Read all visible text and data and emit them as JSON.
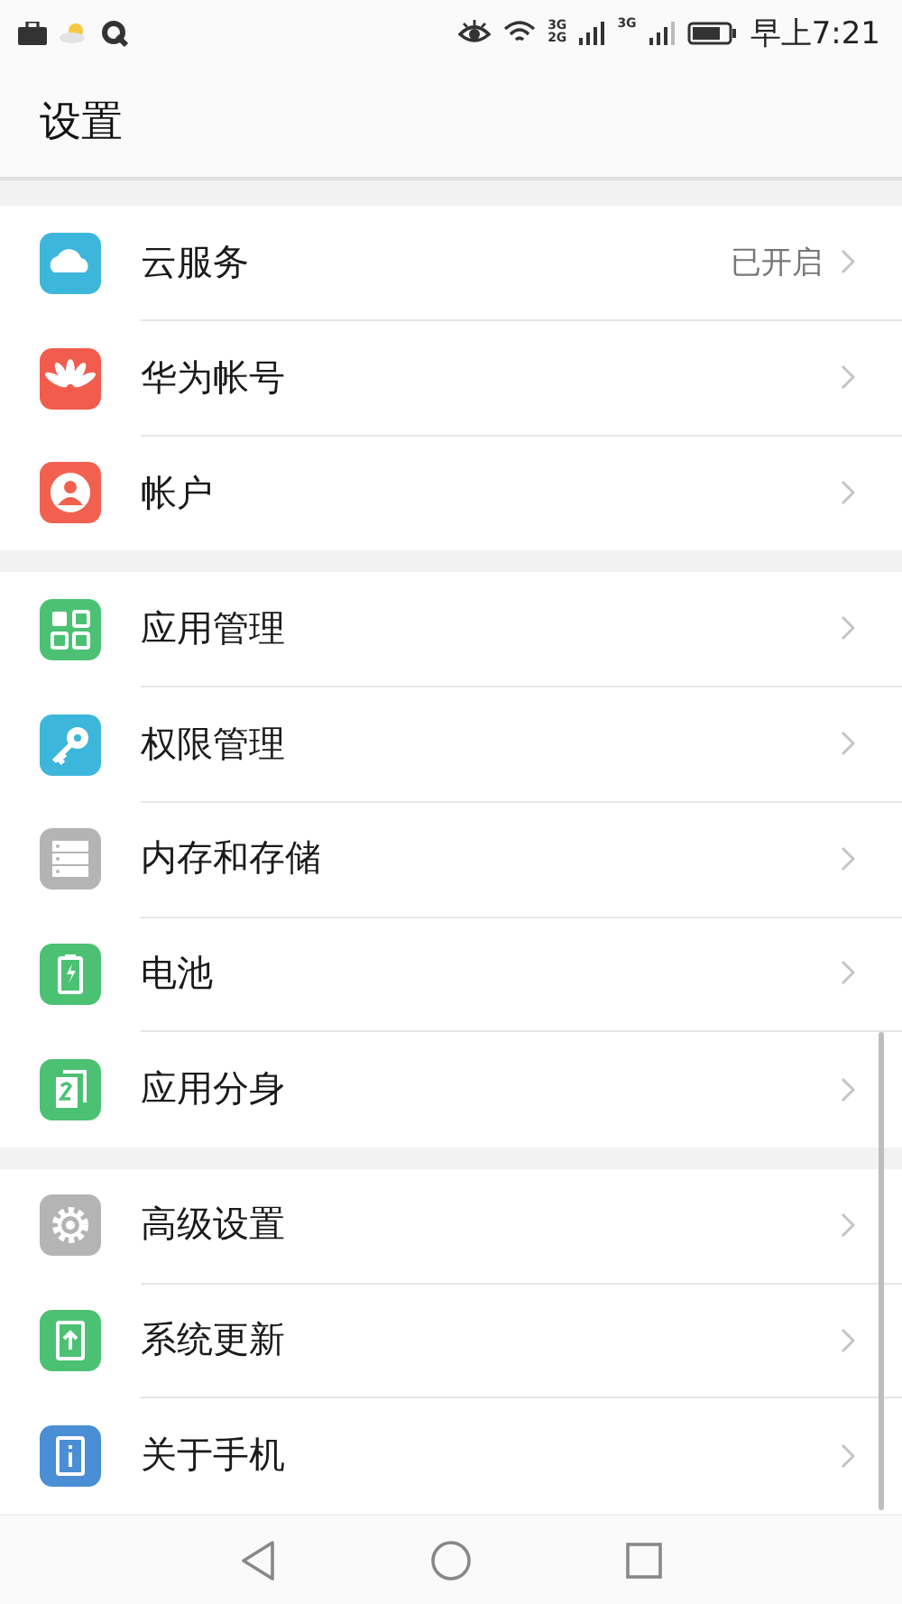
{
  "status_bar": {
    "network_labels": [
      "3G",
      "2G",
      "3G"
    ],
    "time": "早上7:21"
  },
  "header": {
    "title": "设置"
  },
  "groups": [
    {
      "items": [
        {
          "label": "云服务",
          "value": "已开启"
        },
        {
          "label": "华为帐号"
        },
        {
          "label": "帐户"
        }
      ]
    },
    {
      "items": [
        {
          "label": "应用管理"
        },
        {
          "label": "权限管理"
        },
        {
          "label": "内存和存储"
        },
        {
          "label": "电池"
        },
        {
          "label": "应用分身"
        }
      ]
    },
    {
      "items": [
        {
          "label": "高级设置"
        },
        {
          "label": "系统更新"
        },
        {
          "label": "关于手机"
        }
      ]
    }
  ]
}
